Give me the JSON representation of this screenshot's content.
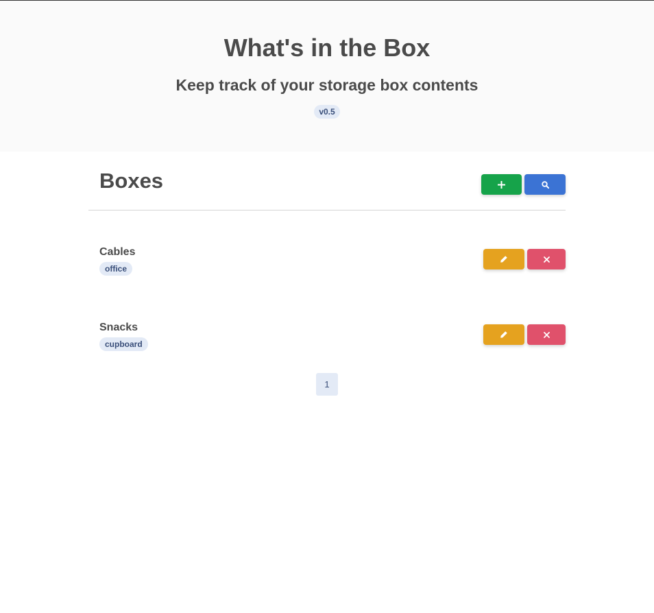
{
  "hero": {
    "title": "What's in the Box",
    "subtitle": "Keep track of your storage box contents",
    "version": "v0.5"
  },
  "boxes_section": {
    "title": "Boxes",
    "add_icon": "plus-icon",
    "search_icon": "search-icon"
  },
  "boxes": [
    {
      "name": "Cables",
      "tag": "office",
      "edit_icon": "pencil-icon",
      "delete_icon": "close-icon"
    },
    {
      "name": "Snacks",
      "tag": "cupboard",
      "edit_icon": "pencil-icon",
      "delete_icon": "close-icon"
    }
  ],
  "pagination": {
    "current_page": "1"
  },
  "colors": {
    "add": "#16a34a",
    "search": "#3b73d4",
    "edit": "#e5a21f",
    "delete": "#e0516b",
    "badge_bg": "#e3eaf6",
    "hero_bg": "#fafafa"
  }
}
